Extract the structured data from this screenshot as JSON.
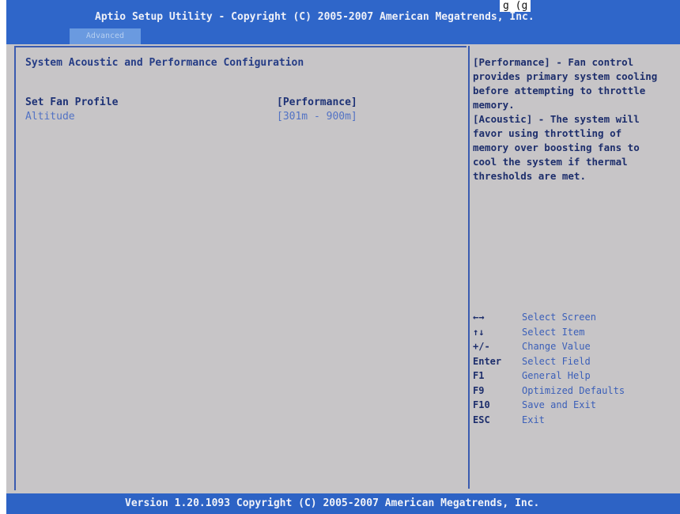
{
  "header": {
    "title": "Aptio Setup Utility - Copyright (C) 2005-2007 American Megatrends, Inc.",
    "note": "g  (g",
    "tab": "Advanced"
  },
  "main": {
    "section_title": "System Acoustic and Performance Configuration",
    "settings": [
      {
        "label": "Set Fan Profile",
        "value": "[Performance]"
      },
      {
        "label": "Altitude",
        "value": "[301m - 900m]"
      }
    ]
  },
  "help": {
    "text": "[Performance] - Fan control\nprovides primary system cooling\nbefore attempting to throttle\nmemory.\n[Acoustic] - The system will\nfavor using throttling of\nmemory over boosting fans to\ncool the system if thermal\nthresholds are met."
  },
  "keys": [
    {
      "key": "←→",
      "desc": "Select Screen"
    },
    {
      "key": "↑↓",
      "desc": "Select Item"
    },
    {
      "key": "+/-",
      "desc": "Change Value"
    },
    {
      "key": "Enter",
      "desc": "Select Field"
    },
    {
      "key": "F1",
      "desc": "General Help"
    },
    {
      "key": "F9",
      "desc": "Optimized Defaults"
    },
    {
      "key": "F10",
      "desc": "Save and Exit"
    },
    {
      "key": "ESC",
      "desc": "Exit"
    }
  ],
  "footer": {
    "text": "Version 1.20.1093 Copyright (C) 2005-2007 American Megatrends, Inc."
  },
  "colors": {
    "header_bg": "#2f66c9",
    "screen_bg": "#c7c5c7",
    "text_blue": "#1d2e6c",
    "dim_blue": "#5272c4"
  }
}
